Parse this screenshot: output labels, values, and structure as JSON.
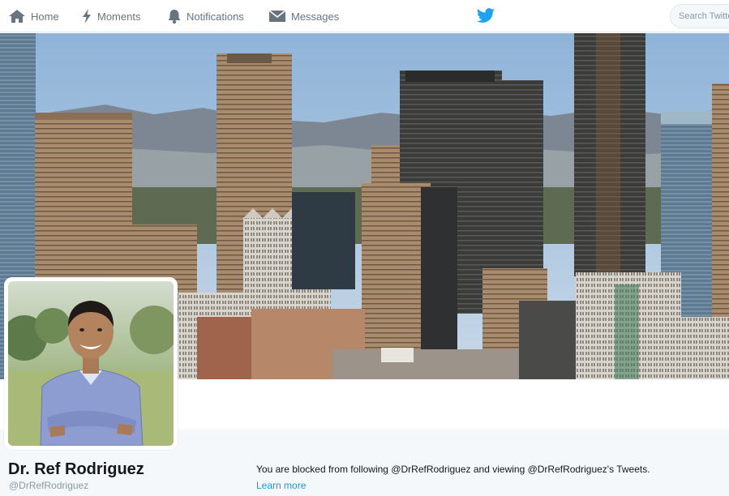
{
  "nav": {
    "items": [
      {
        "label": "Home",
        "icon": "home-icon"
      },
      {
        "label": "Moments",
        "icon": "lightning-icon"
      },
      {
        "label": "Notifications",
        "icon": "bell-icon"
      },
      {
        "label": "Messages",
        "icon": "envelope-icon"
      }
    ],
    "logo": "twitter-bird-icon",
    "search_placeholder": "Search Twitter"
  },
  "header": {
    "image": "downtown-los-angeles-skyline-photo"
  },
  "profile": {
    "avatar": "profile-photo",
    "name": "Dr. Ref Rodriguez",
    "handle": "@DrRefRodriguez"
  },
  "notice": {
    "message": "You are blocked from following @DrRefRodriguez and viewing @DrRefRodriguez's Tweets.",
    "link": "Learn more"
  },
  "colors": {
    "brand": "#1da1f2",
    "link": "#1b95e0",
    "muted": "#8899a6",
    "nav_text": "#66757f",
    "profile_band": "#f5f8fa"
  }
}
